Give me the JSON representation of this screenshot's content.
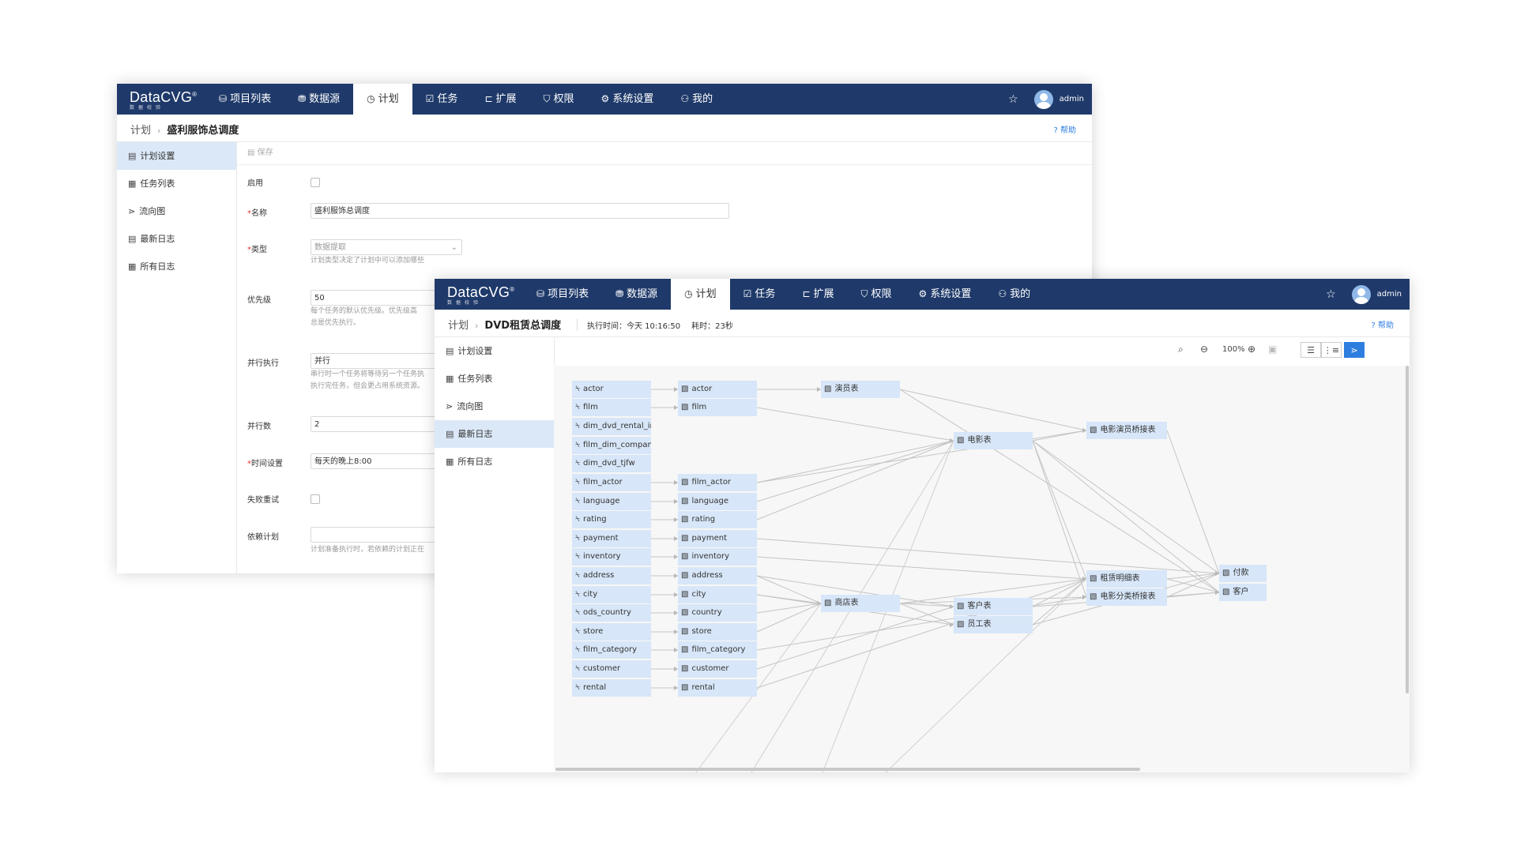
{
  "nav": {
    "logo": "DataCVG",
    "logo_reg": "®",
    "logo_sub": "数据校验",
    "items": [
      {
        "icon": "⛁",
        "label": "项目列表"
      },
      {
        "icon": "⛃",
        "label": "数据源"
      },
      {
        "icon": "◷",
        "label": "计划"
      },
      {
        "icon": "☑",
        "label": "任务"
      },
      {
        "icon": "⊏",
        "label": "扩展"
      },
      {
        "icon": "⛉",
        "label": "权限"
      },
      {
        "icon": "⚙",
        "label": "系统设置"
      },
      {
        "icon": "⚇",
        "label": "我的"
      }
    ],
    "active_index": 2,
    "star": "☆",
    "user": "admin"
  },
  "sidebar": [
    {
      "icon": "▤",
      "label": "计划设置"
    },
    {
      "icon": "▦",
      "label": "任务列表"
    },
    {
      "icon": "⋗",
      "label": "流向图"
    },
    {
      "icon": "▤",
      "label": "最新日志"
    },
    {
      "icon": "▦",
      "label": "所有日志"
    }
  ],
  "help": "帮助",
  "help_icon": "?",
  "win1": {
    "breadcrumb_root": "计划",
    "breadcrumb_current": "盛利服饰总调度",
    "save": "保存",
    "form": {
      "enable_label": "启用",
      "name_label": "名称",
      "name_value": "盛利服饰总调度",
      "type_label": "类型",
      "type_value": "数据提取",
      "type_hint": "计划类型决定了计划中可以添加哪些",
      "priority_label": "优先级",
      "priority_value": "50",
      "priority_hint1": "每个任务的默认优先级。优先级高",
      "priority_hint2": "总是优先执行。",
      "parallel_label": "并行执行",
      "parallel_value": "并行",
      "parallel_hint1": "串行时一个任务将等待另一个任务执",
      "parallel_hint2": "执行完任务，但会更占用系统资源。",
      "concurrency_label": "并行数",
      "concurrency_value": "2",
      "time_label": "时间设置",
      "time_value": "每天的晚上8:00",
      "retry_label": "失败重试",
      "depend_label": "依赖计划",
      "depend_hint": "计划准备执行时，若依赖的计划正在"
    }
  },
  "win2": {
    "breadcrumb_root": "计划",
    "breadcrumb_current": "DVD租赁总调度",
    "exec_time": "执行时间：今天 10:16:50",
    "duration": "耗时：23秒",
    "zoom": "100%",
    "source_nodes": [
      "actor",
      "film",
      "dim_dvd_rental_indi...",
      "film_dim_company",
      "dim_dvd_tjfw",
      "film_actor",
      "language",
      "rating",
      "payment",
      "inventory",
      "address",
      "city",
      "ods_country",
      "store",
      "film_category",
      "customer",
      "rental"
    ],
    "ods_nodes": [
      "actor",
      "film",
      "film_actor",
      "language",
      "rating",
      "payment",
      "inventory",
      "address",
      "city",
      "country",
      "store",
      "film_category",
      "customer",
      "rental"
    ],
    "dim_nodes": [
      "演员表",
      "电影表",
      "商店表",
      "客户表",
      "员工表",
      "电影演员桥接表",
      "租赁明细表",
      "电影分类桥接表",
      "付款",
      "客户"
    ]
  }
}
